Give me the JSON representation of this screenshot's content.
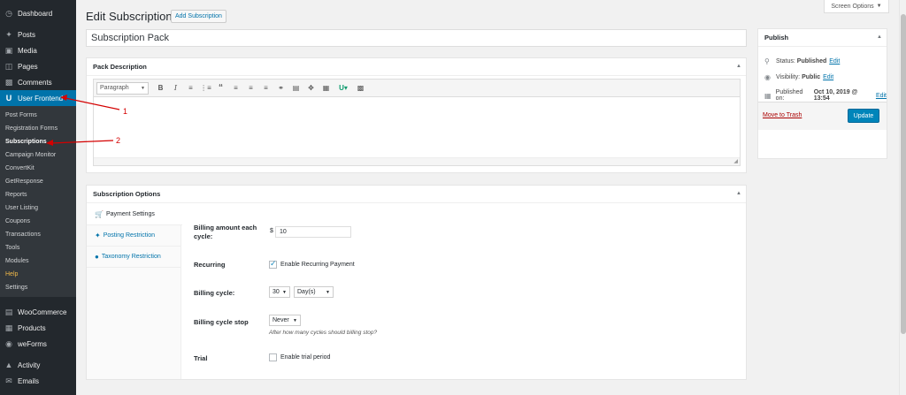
{
  "sidebar": {
    "top_items": [
      {
        "label": "Dashboard",
        "icon": "dashboard-icon"
      },
      {
        "label": "Posts",
        "icon": "pin-icon"
      },
      {
        "label": "Media",
        "icon": "media-icon"
      },
      {
        "label": "Pages",
        "icon": "pages-icon"
      },
      {
        "label": "Comments",
        "icon": "comment-icon"
      },
      {
        "label": "User Frontend",
        "icon": "user-frontend-icon"
      }
    ],
    "submenu": [
      "Post Forms",
      "Registration Forms",
      "Subscriptions",
      "Campaign Monitor",
      "ConvertKit",
      "GetResponse",
      "Reports",
      "User Listing",
      "Coupons",
      "Transactions",
      "Tools",
      "Modules",
      "Help",
      "Settings"
    ],
    "bottom_items": [
      {
        "label": "WooCommerce",
        "icon": "woocommerce-icon"
      },
      {
        "label": "Products",
        "icon": "products-icon"
      },
      {
        "label": "weForms",
        "icon": "weforms-icon"
      },
      {
        "label": "Activity",
        "icon": "activity-icon"
      },
      {
        "label": "Emails",
        "icon": "email-icon"
      }
    ]
  },
  "header": {
    "title": "Edit Subscription",
    "add_button": "Add Subscription",
    "screen_options": "Screen Options"
  },
  "title_value": "Subscription Pack",
  "pack_description": {
    "heading": "Pack Description",
    "format_select": "Paragraph",
    "toolbar_icons": [
      "bold-icon",
      "italic-icon",
      "bullet-list-icon",
      "numbered-list-icon",
      "blockquote-icon",
      "align-left-icon",
      "align-center-icon",
      "align-right-icon",
      "link-icon",
      "more-tag-icon",
      "fullscreen-icon",
      "toolbar-toggle-icon",
      "user-frontend-icon",
      "kitchen-sink-icon"
    ],
    "bold": "B",
    "italic": "I"
  },
  "subscription_options": {
    "heading": "Subscription Options",
    "tabs": [
      {
        "label": "Payment Settings",
        "icon": "cart-icon"
      },
      {
        "label": "Posting Restriction",
        "icon": "pin-icon"
      },
      {
        "label": "Taxonomy Restriction",
        "icon": "groups-icon"
      }
    ],
    "billing_amount_label": "Billing amount each cycle:",
    "currency_symbol": "$",
    "billing_amount_value": "10",
    "recurring_label": "Recurring",
    "recurring_option": "Enable Recurring Payment",
    "billing_cycle_label": "Billing cycle:",
    "billing_cycle_number": "30",
    "billing_cycle_unit": "Day(s)",
    "billing_stop_label": "Billing cycle stop",
    "billing_stop_value": "Never",
    "billing_stop_hint": "After how many cycles should billing stop?",
    "trial_label": "Trial",
    "trial_option": "Enable trial period"
  },
  "publish": {
    "heading": "Publish",
    "status_label": "Status:",
    "status_value": "Published",
    "visibility_label": "Visibility:",
    "visibility_value": "Public",
    "published_label": "Published on:",
    "published_value": "Oct 10, 2019 @ 13:54",
    "edit_link": "Edit",
    "trash": "Move to Trash",
    "update": "Update"
  },
  "annotations": {
    "one": "1",
    "two": "2"
  },
  "colors": {
    "accent": "#0073aa",
    "sidebar": "#23282d",
    "annotation": "#d40000"
  }
}
